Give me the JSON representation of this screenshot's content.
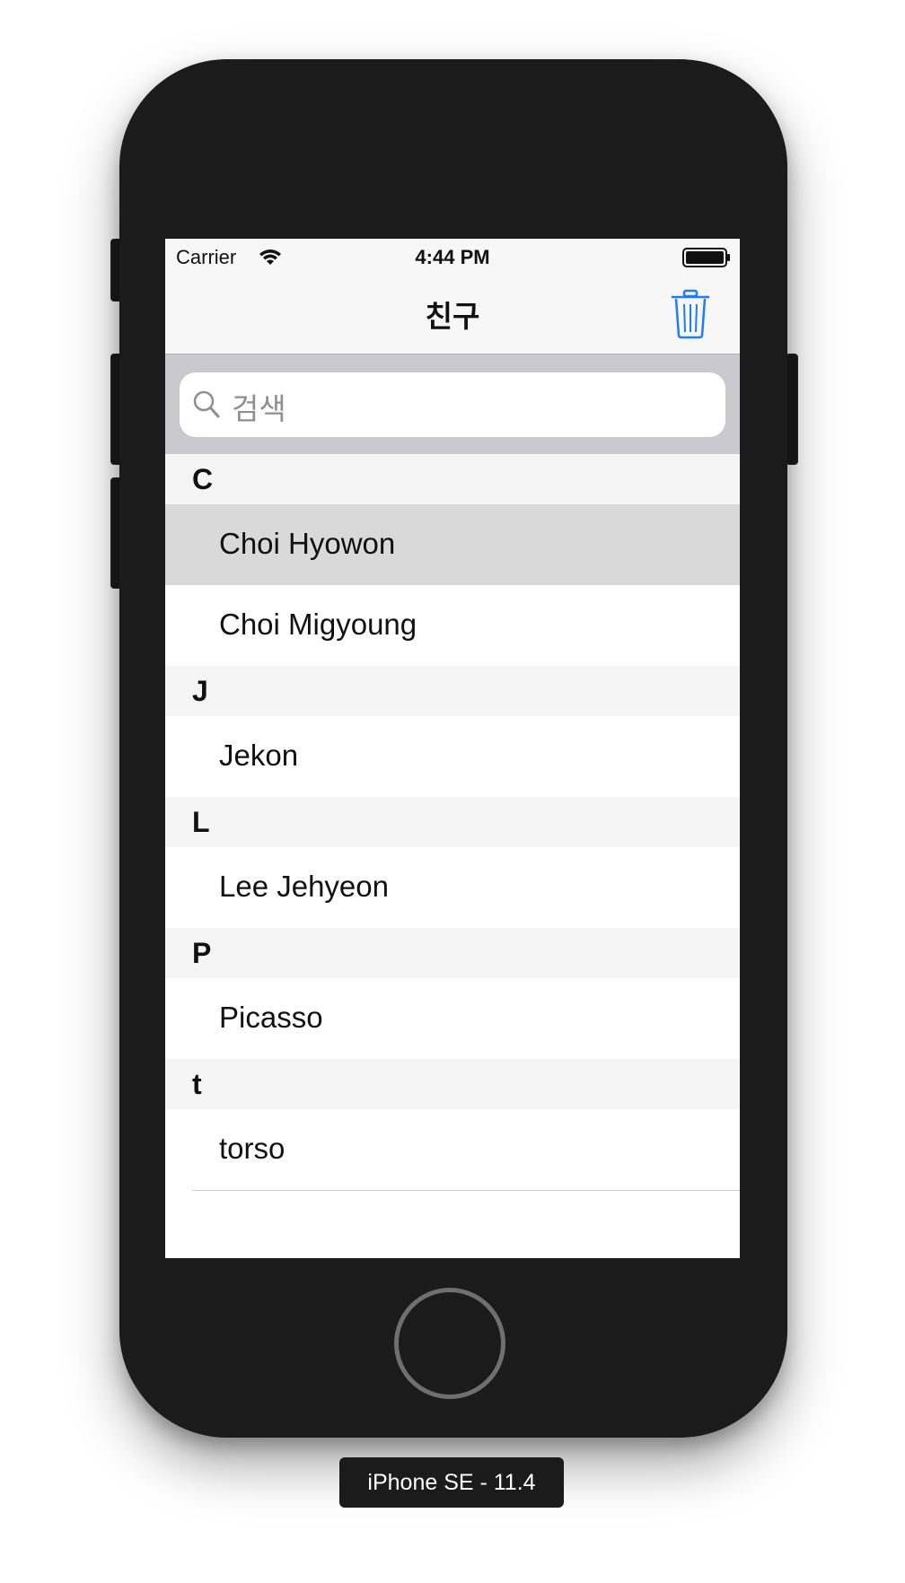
{
  "status_bar": {
    "carrier": "Carrier",
    "time": "4:44 PM"
  },
  "nav_bar": {
    "title": "친구",
    "trash_icon": "trash-icon"
  },
  "search": {
    "placeholder": "검색",
    "icon": "search-icon"
  },
  "sections": [
    {
      "title": "C",
      "rows": [
        "Choi Hyowon",
        "Choi Migyoung"
      ]
    },
    {
      "title": "J",
      "rows": [
        "Jekon"
      ]
    },
    {
      "title": "L",
      "rows": [
        "Lee Jehyeon"
      ]
    },
    {
      "title": "P",
      "rows": [
        "Picasso"
      ]
    },
    {
      "title": "t",
      "rows": [
        "torso"
      ]
    }
  ],
  "selected_row": "Choi Hyowon",
  "device_label": "iPhone SE - 11.4",
  "colors": {
    "device_body": "#1b1b1b",
    "accent_blue": "#1e7cf5",
    "selected_row_bg": "#d9d9d9",
    "section_header_bg": "#f5f5f5",
    "search_bar_bg": "#c9c9ce"
  }
}
